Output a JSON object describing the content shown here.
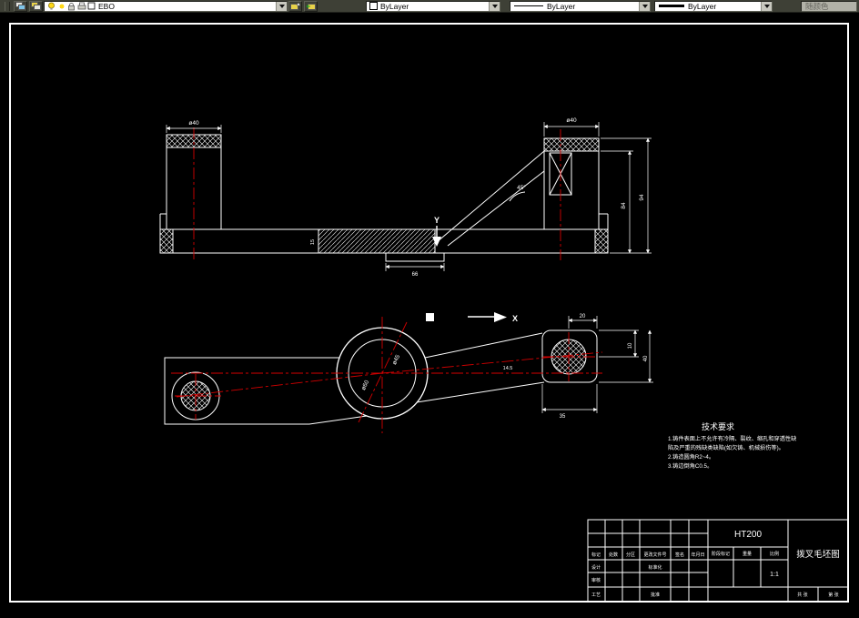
{
  "toolbar": {
    "layer_combo": {
      "layer_name": "EBO"
    },
    "color_combo": {
      "value": "ByLayer"
    },
    "linetype_combo": {
      "value": "ByLayer"
    },
    "lineweight_combo": {
      "value": "ByLayer"
    },
    "plot_style_combo": {
      "value": "随颜色"
    }
  },
  "section_labels": {
    "y": "Y",
    "x": "X"
  },
  "dims": {
    "top_left_dia": "ø40",
    "top_right_dia": "ø40",
    "angle": "45°",
    "overall_height": "94",
    "inner_height": "84",
    "base_band": "15",
    "boss_width": "66",
    "lobe_offset": "20",
    "lobe_top": "10",
    "lobe_height": "40",
    "lobe_width": "35",
    "arm_offset": "14.5",
    "hub_outer_dia": "ø60",
    "hub_inner_dia": "ø45"
  },
  "tech_requirements": {
    "title": "技术要求",
    "lines": [
      "1.铸件表面上不允许有冷隔、裂纹、缩孔和穿透性缺",
      "陷及严重的残缺类缺陷(如欠铸、机械损伤等)。",
      "2.铸造圆角R2~4。",
      "3.铸边倒角C0.5。"
    ]
  },
  "title_block": {
    "material": "HT200",
    "drawing_title": "拨叉毛坯图",
    "scale_value": "1:1",
    "labels": {
      "mark": "标记",
      "count": "处数",
      "zone": "分区",
      "change_file_no": "更改文件号",
      "signature": "签名",
      "date": "年月日",
      "design": "设计",
      "standardization": "标准化",
      "stage_mark": "阶段标记",
      "weight": "重量",
      "scale": "比例",
      "review": "审核",
      "process": "工艺",
      "approve": "批准",
      "sheets_total": "共 张",
      "sheet_no": "第 张"
    }
  }
}
